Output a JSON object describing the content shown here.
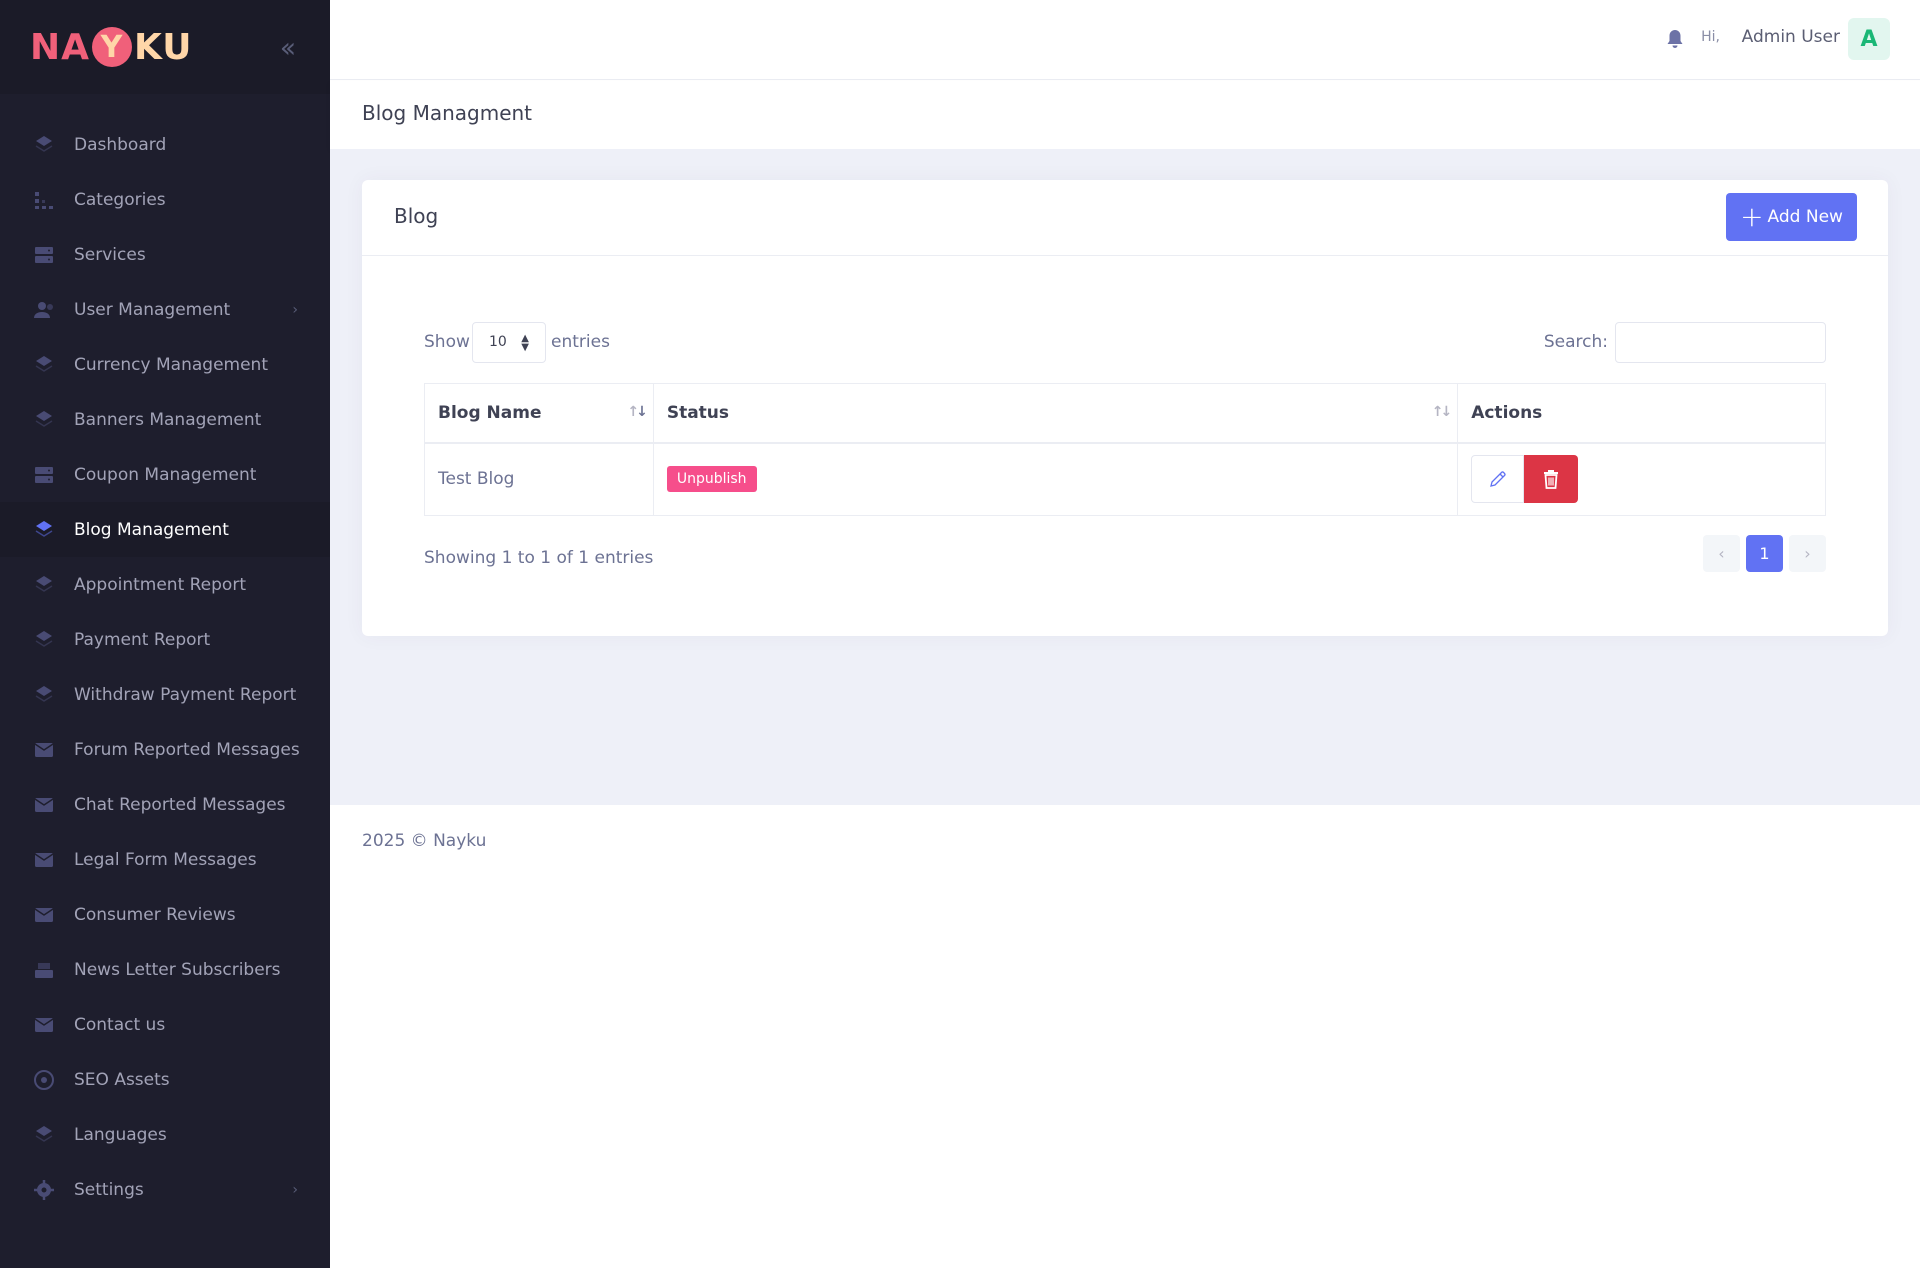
{
  "brand": {
    "logo_parts": [
      "NA",
      "Y",
      "KU"
    ],
    "collapse_icon": "double-chevron-left-icon"
  },
  "sidebar": {
    "items": [
      {
        "label": "Dashboard",
        "icon": "layers-icon",
        "active": false,
        "has_children": false
      },
      {
        "label": "Categories",
        "icon": "bar-chart-icon",
        "active": false,
        "has_children": false
      },
      {
        "label": "Services",
        "icon": "server-icon",
        "active": false,
        "has_children": false
      },
      {
        "label": "User Management",
        "icon": "users-icon",
        "active": false,
        "has_children": true
      },
      {
        "label": "Currency Management",
        "icon": "layers-icon",
        "active": false,
        "has_children": false
      },
      {
        "label": "Banners Management",
        "icon": "layers-icon",
        "active": false,
        "has_children": false
      },
      {
        "label": "Coupon Management",
        "icon": "server-icon",
        "active": false,
        "has_children": false
      },
      {
        "label": "Blog Management",
        "icon": "layers-icon",
        "active": true,
        "has_children": false
      },
      {
        "label": "Appointment Report",
        "icon": "layers-icon",
        "active": false,
        "has_children": false
      },
      {
        "label": "Payment Report",
        "icon": "layers-icon",
        "active": false,
        "has_children": false
      },
      {
        "label": "Withdraw Payment Report",
        "icon": "layers-icon",
        "active": false,
        "has_children": false
      },
      {
        "label": "Forum Reported Messages",
        "icon": "mail-icon",
        "active": false,
        "has_children": false
      },
      {
        "label": "Chat Reported Messages",
        "icon": "mail-icon",
        "active": false,
        "has_children": false
      },
      {
        "label": "Legal Form Messages",
        "icon": "mail-icon",
        "active": false,
        "has_children": false
      },
      {
        "label": "Consumer Reviews",
        "icon": "mail-icon",
        "active": false,
        "has_children": false
      },
      {
        "label": "News Letter Subscribers",
        "icon": "inbox-icon",
        "active": false,
        "has_children": false
      },
      {
        "label": "Contact us",
        "icon": "envelope-icon",
        "active": false,
        "has_children": false
      },
      {
        "label": "SEO Assets",
        "icon": "compass-icon",
        "active": false,
        "has_children": false
      },
      {
        "label": "Languages",
        "icon": "layers-icon",
        "active": false,
        "has_children": false
      },
      {
        "label": "Settings",
        "icon": "gear-icon",
        "active": false,
        "has_children": true
      }
    ]
  },
  "header": {
    "greeting": "Hi,",
    "user_name": "Admin User",
    "avatar_letter": "A",
    "bell_icon": "bell-icon"
  },
  "subheader": {
    "title": "Blog Managment"
  },
  "card": {
    "title": "Blog",
    "add_button": {
      "icon": "plus-icon",
      "label": "Add New"
    },
    "length": {
      "show": "Show",
      "value": "10",
      "entries": "entries"
    },
    "search": {
      "label": "Search:",
      "value": ""
    },
    "table": {
      "headers": {
        "name": "Blog Name",
        "status": "Status",
        "actions": "Actions"
      },
      "rows": [
        {
          "name": "Test Blog",
          "status": "Unpublish"
        }
      ]
    },
    "info": "Showing 1 to 1 of 1 entries",
    "pagination": {
      "prev": "‹",
      "current": "1",
      "next": "›"
    }
  },
  "footer": {
    "copyright": "2025 © Nayku"
  },
  "colors": {
    "accent": "#6172f3",
    "sidebar_bg": "#1e1e2d",
    "danger": "#dc3545",
    "badge": "#f64e8b",
    "icon_muted": "#494b74"
  }
}
